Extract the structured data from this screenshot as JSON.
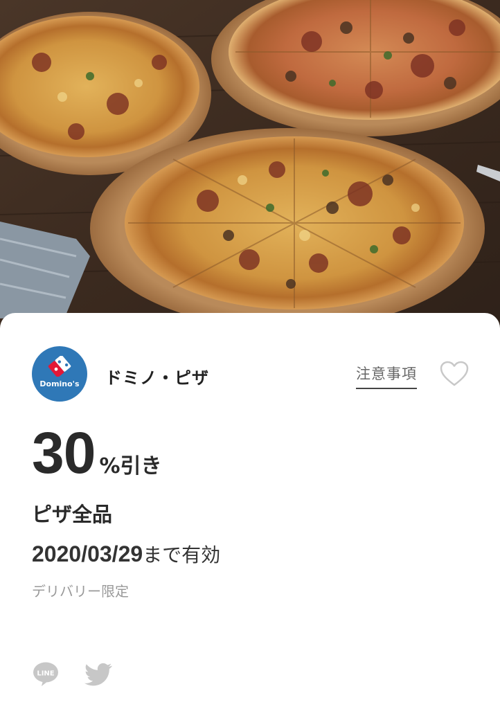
{
  "brand": {
    "logo_text": "Domino's",
    "name": "ドミノ・ピザ",
    "color": "#2f78b7"
  },
  "header_actions": {
    "notes_label": "注意事項",
    "favorite_icon": "heart-outline-icon"
  },
  "coupon": {
    "discount_value": "30",
    "discount_unit": "%引き",
    "product": "ピザ全品",
    "expiry_date": "2020/03/29",
    "expiry_suffix": "まで有効",
    "note": "デリバリー限定"
  },
  "share": {
    "line_label": "LINE",
    "line_icon": "line-icon",
    "twitter_icon": "twitter-bird-icon"
  }
}
